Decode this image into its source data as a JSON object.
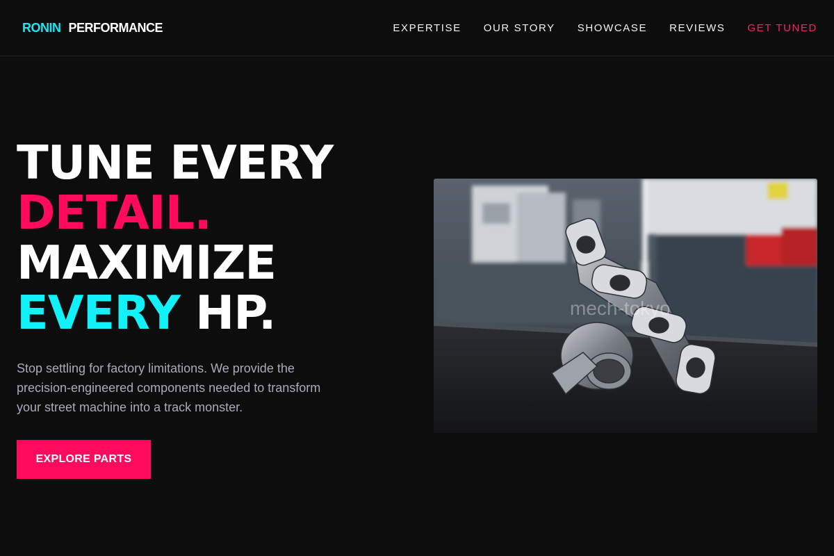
{
  "brand": {
    "part1": "RONIN",
    "part2": "PERFORMANCE"
  },
  "nav": {
    "items": [
      {
        "label": "EXPERTISE"
      },
      {
        "label": "OUR STORY"
      },
      {
        "label": "SHOWCASE"
      },
      {
        "label": "REVIEWS"
      }
    ],
    "cta": "GET TUNED"
  },
  "hero": {
    "line1": "TUNE EVERY",
    "line2": "DETAIL.",
    "line3": "MAXIMIZE",
    "line4_accent": "EVERY",
    "line4_rest": "HP.",
    "subtitle": "Stop settling for factory limitations. We provide the precision-engineered components needed to transform your street machine into a track monster.",
    "button": "EXPLORE PARTS"
  },
  "image": {
    "watermark": "mech-tokyo"
  },
  "colors": {
    "accent_pink": "#ff0a5c",
    "accent_cyan": "#11f1f7",
    "background": "#0d0d0e"
  }
}
